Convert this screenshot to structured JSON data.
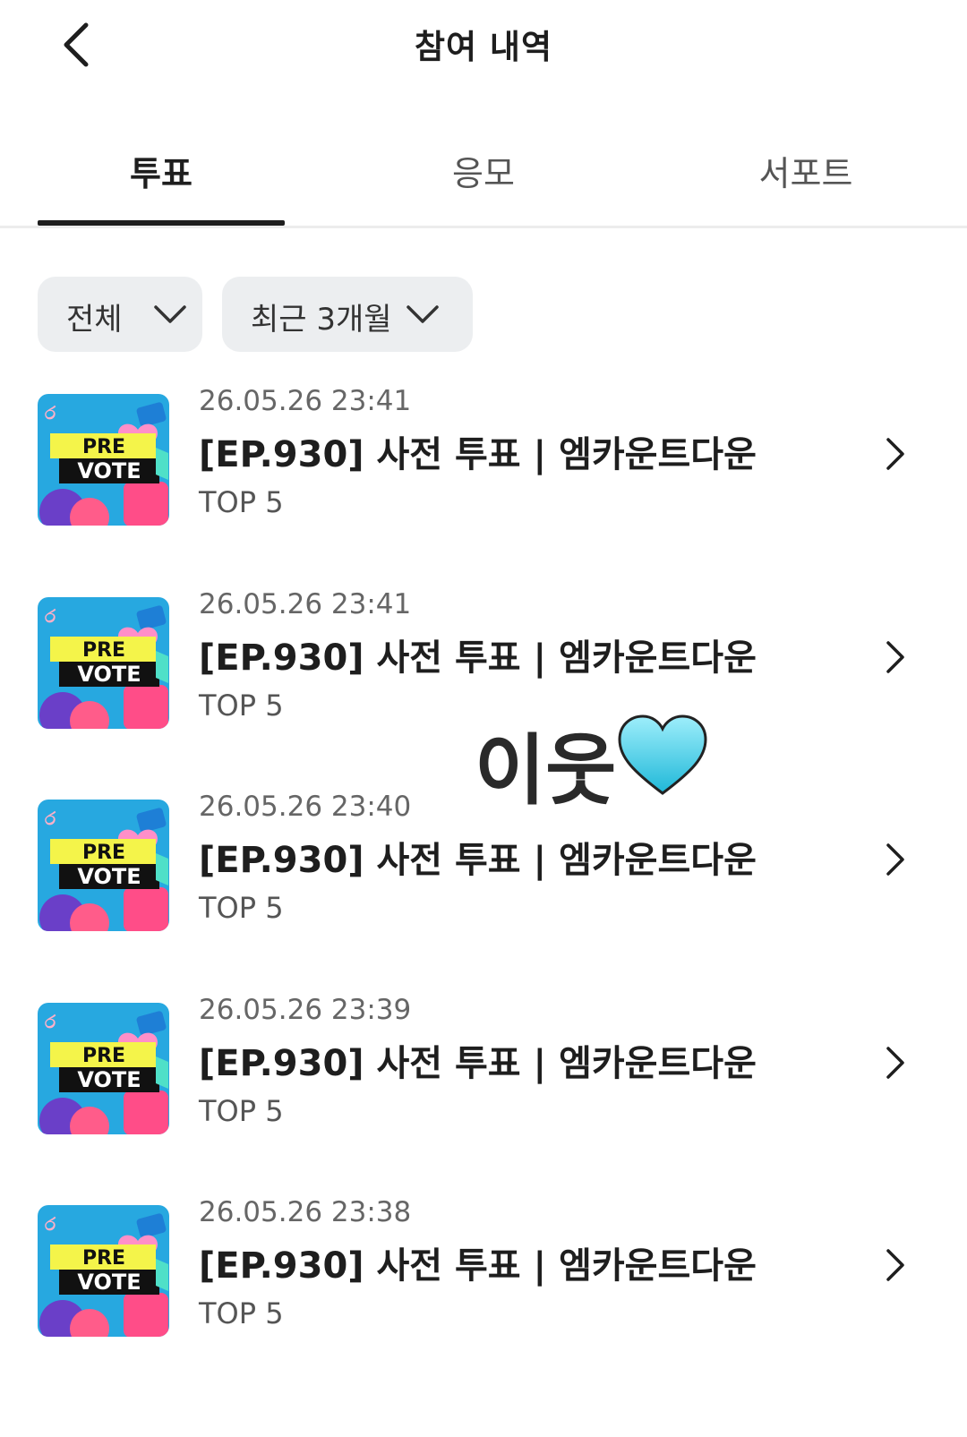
{
  "header": {
    "title": "참여 내역",
    "back_icon": "chevron-left-icon"
  },
  "tabs": [
    {
      "label": "투표",
      "active": true
    },
    {
      "label": "응모",
      "active": false
    },
    {
      "label": "서포트",
      "active": false
    }
  ],
  "filters": [
    {
      "label": "전체",
      "icon": "chevron-down-icon"
    },
    {
      "label": "최근 3개월",
      "icon": "chevron-down-icon"
    }
  ],
  "thumbnail": {
    "line1": "PRE",
    "line2": "VOTE",
    "badge": "ර"
  },
  "items": [
    {
      "date": "26.05.26 23:41",
      "title": "[EP.930] 사전 투표 | 엠카운트다운",
      "sub": "TOP 5"
    },
    {
      "date": "26.05.26 23:41",
      "title": "[EP.930] 사전 투표 | 엠카운트다운",
      "sub": "TOP 5"
    },
    {
      "date": "26.05.26 23:40",
      "title": "[EP.930] 사전 투표 | 엠카운트다운",
      "sub": "TOP 5"
    },
    {
      "date": "26.05.26 23:39",
      "title": "[EP.930] 사전 투표 | 엠카운트다운",
      "sub": "TOP 5"
    },
    {
      "date": "26.05.26 23:38",
      "title": "[EP.930] 사전 투표 | 엠카운트다운",
      "sub": "TOP 5"
    }
  ],
  "sticker": {
    "text": "이웃",
    "icon": "light-blue-heart-icon"
  },
  "colors": {
    "text": "#1e1e1e",
    "filter_bg": "#eceef0",
    "heart": "#4fd3ec"
  }
}
